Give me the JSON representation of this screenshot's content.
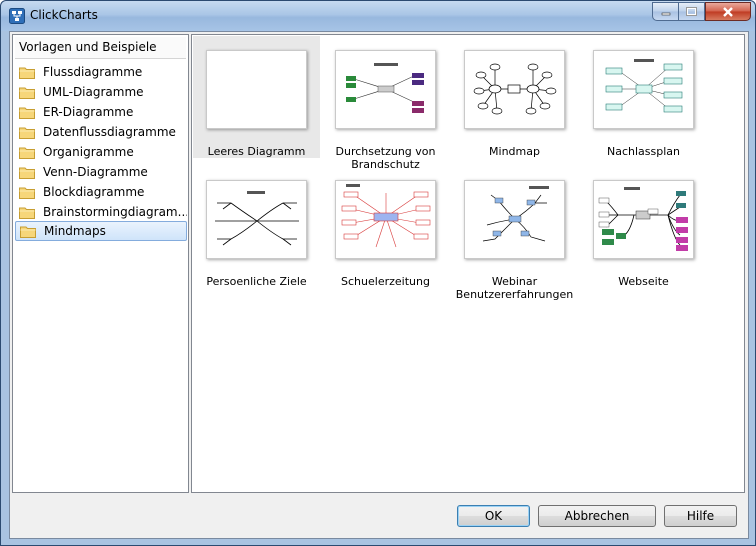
{
  "window": {
    "title": "ClickCharts"
  },
  "tree": {
    "header": "Vorlagen und Beispiele",
    "items": [
      {
        "label": "Flussdiagramme"
      },
      {
        "label": "UML-Diagramme"
      },
      {
        "label": "ER-Diagramme"
      },
      {
        "label": "Datenflussdiagramme"
      },
      {
        "label": "Organigramme"
      },
      {
        "label": "Venn-Diagramme"
      },
      {
        "label": "Blockdiagramme"
      },
      {
        "label": "Brainstormingdiagram..."
      },
      {
        "label": "Mindmaps"
      }
    ],
    "selected": "Mindmaps"
  },
  "templates": [
    {
      "label": "Leeres Diagramm"
    },
    {
      "label": "Durchsetzung von Brandschutz"
    },
    {
      "label": "Mindmap"
    },
    {
      "label": "Nachlassplan"
    },
    {
      "label": "Persoenliche Ziele"
    },
    {
      "label": "Schuelerzeitung"
    },
    {
      "label": "Webinar Benutzererfahrungen"
    },
    {
      "label": "Webseite"
    }
  ],
  "selected_template": "Leeres Diagramm",
  "buttons": {
    "ok": "OK",
    "cancel": "Abbrechen",
    "help": "Hilfe"
  },
  "colors": {
    "title_bar": "#a9c3e1",
    "selection": "#cfe4fa",
    "close_button": "#c9452e"
  }
}
